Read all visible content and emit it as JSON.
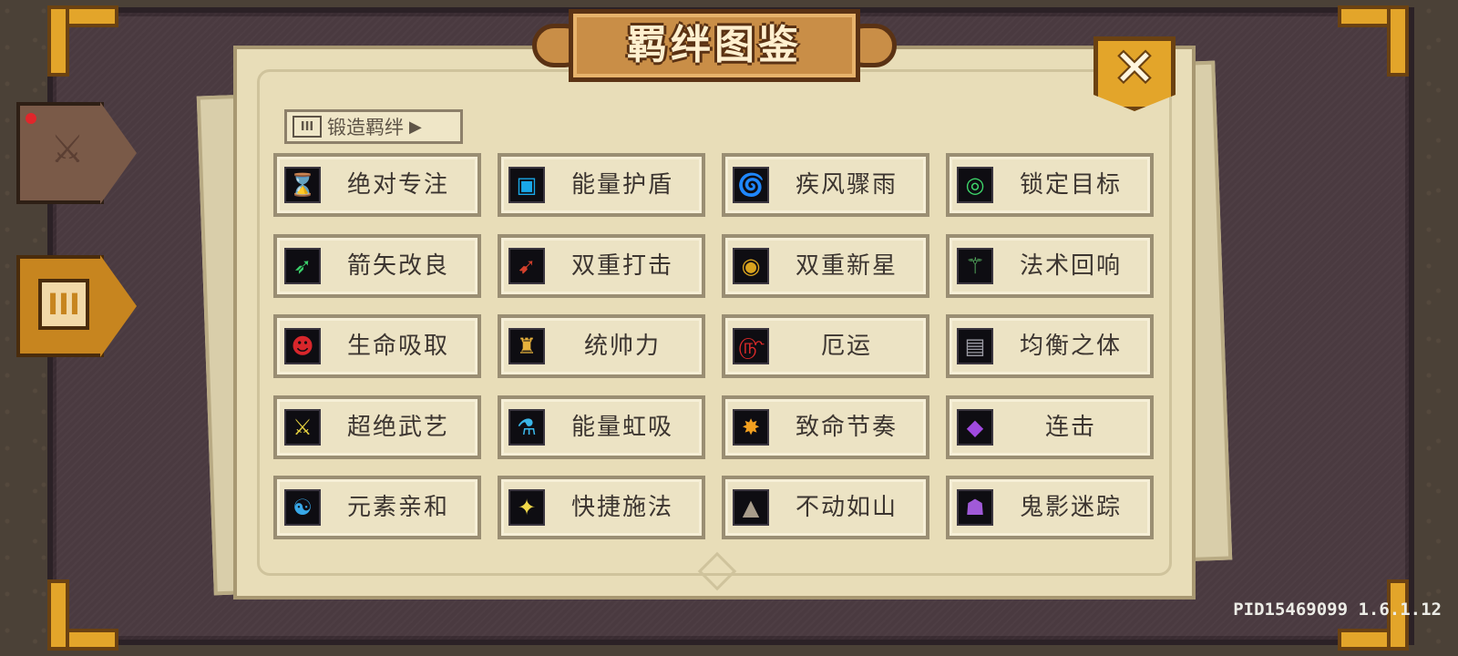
{
  "title": "羁绊图鉴",
  "forge_label": "锻造羁绊",
  "close_icon": "✕",
  "version_text": "PID15469099 1.6.1.12",
  "side_tabs": [
    {
      "icon": "sword-icon"
    },
    {
      "icon": "book-icon"
    }
  ],
  "bonds": [
    {
      "label": "绝对专注",
      "icon": "hourglass-icon",
      "glyph": "⌛",
      "color": "#2c6fd6"
    },
    {
      "label": "能量护盾",
      "icon": "shield-icon",
      "glyph": "▣",
      "color": "#19a8e8"
    },
    {
      "label": "疾风骤雨",
      "icon": "tornado-icon",
      "glyph": "🌀",
      "color": "#9a4fd0"
    },
    {
      "label": "锁定目标",
      "icon": "target-icon",
      "glyph": "◎",
      "color": "#3ed66a"
    },
    {
      "label": "箭矢改良",
      "icon": "arrows-icon",
      "glyph": "➶",
      "color": "#3ad06a"
    },
    {
      "label": "双重打击",
      "icon": "bow-icon",
      "glyph": "➹",
      "color": "#d4402c"
    },
    {
      "label": "双重新星",
      "icon": "nova-icon",
      "glyph": "◉",
      "color": "#d8a21e"
    },
    {
      "label": "法术回响",
      "icon": "staff-icon",
      "glyph": "⚚",
      "color": "#5fc46a"
    },
    {
      "label": "生命吸取",
      "icon": "skull-icon",
      "glyph": "☻",
      "color": "#d8262b"
    },
    {
      "label": "统帅力",
      "icon": "trophy-icon",
      "glyph": "♜",
      "color": "#e6b13c"
    },
    {
      "label": "厄运",
      "icon": "curse-icon",
      "glyph": "௹",
      "color": "#e02a2a"
    },
    {
      "label": "均衡之体",
      "icon": "armor-icon",
      "glyph": "▤",
      "color": "#9a9aa3"
    },
    {
      "label": "超绝武艺",
      "icon": "blade-icon",
      "glyph": "⚔",
      "color": "#e5d040"
    },
    {
      "label": "能量虹吸",
      "icon": "potion-icon",
      "glyph": "⚗",
      "color": "#3ab6e8"
    },
    {
      "label": "致命节奏",
      "icon": "explosion-icon",
      "glyph": "✸",
      "color": "#f2a020"
    },
    {
      "label": "连击",
      "icon": "crystal-icon",
      "glyph": "◆",
      "color": "#a04ae0"
    },
    {
      "label": "元素亲和",
      "icon": "elements-icon",
      "glyph": "☯",
      "color": "#38a8e8"
    },
    {
      "label": "快捷施法",
      "icon": "bulb-icon",
      "glyph": "✦",
      "color": "#f0d84a"
    },
    {
      "label": "不动如山",
      "icon": "rock-icon",
      "glyph": "▲",
      "color": "#a89c8a"
    },
    {
      "label": "鬼影迷踪",
      "icon": "ghost-icon",
      "glyph": "☗",
      "color": "#a05ad8"
    }
  ]
}
